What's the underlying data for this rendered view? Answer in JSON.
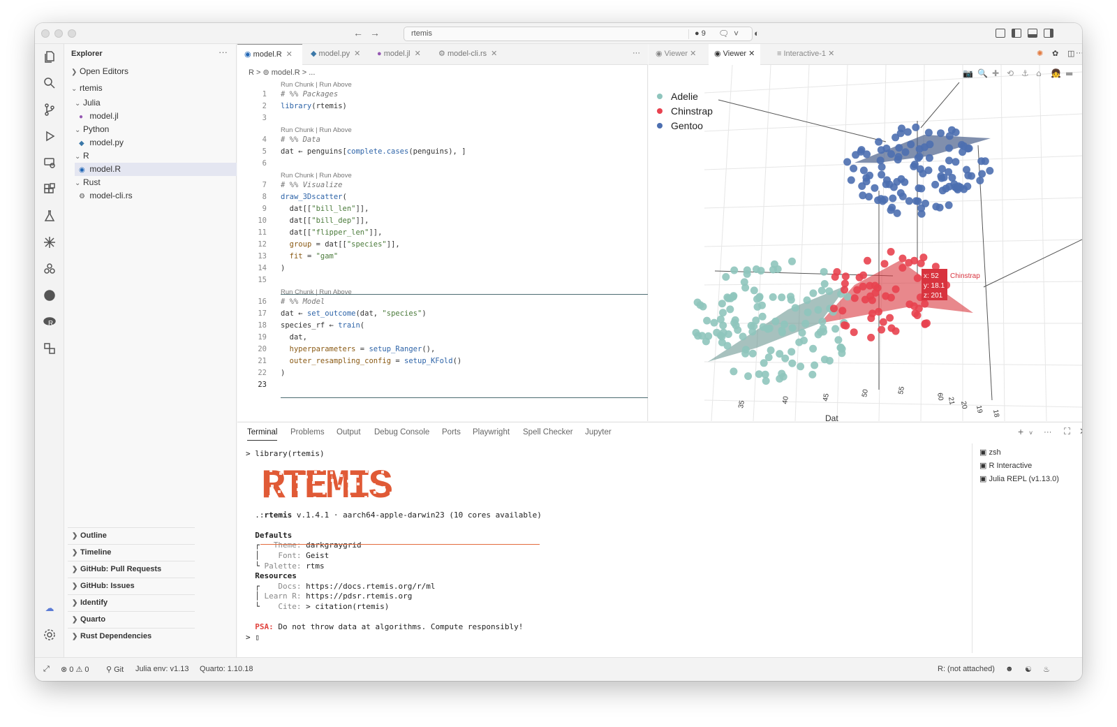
{
  "titlebar": {
    "search_text": "rtemis",
    "badge": "● 9"
  },
  "sidebar": {
    "title": "Explorer",
    "more": "···",
    "open_editors": "Open Editors",
    "folder": "rtemis",
    "tree": [
      {
        "label": "Julia",
        "type": "folder"
      },
      {
        "label": "model.jl",
        "type": "file"
      },
      {
        "label": "Python",
        "type": "folder"
      },
      {
        "label": "model.py",
        "type": "file"
      },
      {
        "label": "R",
        "type": "folder"
      },
      {
        "label": "model.R",
        "type": "file"
      },
      {
        "label": "Rust",
        "type": "folder"
      },
      {
        "label": "model-cli.rs",
        "type": "file"
      }
    ],
    "sections": [
      "Outline",
      "Timeline",
      "GitHub: Pull Requests",
      "GitHub: Issues",
      "Identify",
      "Quarto",
      "Rust Dependencies"
    ]
  },
  "editor": {
    "tabs": [
      "model.R",
      "model.py",
      "model.jl",
      "model-cli.rs"
    ],
    "more": "···",
    "breadcrumb": "R  >  ⊚ model.R  >  ...",
    "lens_label": "Run Chunk | Run Above",
    "lines": [
      {
        "n": "1",
        "text": "# %% Packages"
      },
      {
        "n": "2",
        "text": "library(rtemis)"
      },
      {
        "n": "3",
        "text": ""
      },
      {
        "n": "4",
        "text": "# %% Data"
      },
      {
        "n": "5",
        "text": "dat ← penguins[complete.cases(penguins), ]"
      },
      {
        "n": "6",
        "text": ""
      },
      {
        "n": "7",
        "text": "# %% Visualize"
      },
      {
        "n": "8",
        "text": "draw_3Dscatter("
      },
      {
        "n": "9",
        "text": "  dat[[\"bill_len\"]],"
      },
      {
        "n": "10",
        "text": "  dat[[\"bill_dep\"]],"
      },
      {
        "n": "11",
        "text": "  dat[[\"flipper_len\"]],"
      },
      {
        "n": "12",
        "text": "  group = dat[[\"species\"]],"
      },
      {
        "n": "13",
        "text": "  fit = \"gam\""
      },
      {
        "n": "14",
        "text": ")"
      },
      {
        "n": "15",
        "text": ""
      },
      {
        "n": "16",
        "text": "# %% Model"
      },
      {
        "n": "17",
        "text": "dat ← set_outcome(dat, \"species\")"
      },
      {
        "n": "18",
        "text": "species_rf ← train("
      },
      {
        "n": "19",
        "text": "  dat,"
      },
      {
        "n": "20",
        "text": "  hyperparameters = setup_Ranger(),"
      },
      {
        "n": "21",
        "text": "  outer_resampling_config = setup_KFold()"
      },
      {
        "n": "22",
        "text": ")"
      },
      {
        "n": "23",
        "text": ""
      }
    ]
  },
  "viewer": {
    "tabs": [
      "Viewer",
      "Viewer",
      "Interactive-1"
    ],
    "more": "···",
    "tooltip": {
      "x": "x: 52",
      "y": "y: 18.1",
      "z": "z: 201",
      "group": "Chinstrap"
    },
    "axis_ticks_x": [
      "35",
      "40",
      "45",
      "50",
      "55"
    ],
    "axis_ticks_y": [
      "60",
      "21",
      "20",
      "19",
      "18"
    ],
    "axis_partial": "Dat",
    "colors": {
      "Adelie": "#8fc5bd",
      "Chinstrap": "#e8424f",
      "Gentoo": "#4d6fb0"
    }
  },
  "chart_data": {
    "type": "scatter",
    "series": [
      {
        "name": "Adelie"
      },
      {
        "name": "Chinstrap"
      },
      {
        "name": "Gentoo"
      }
    ],
    "xticks": [
      "35",
      "40",
      "45",
      "50",
      "55"
    ],
    "yticks": [
      "60",
      "21",
      "20",
      "19",
      "18"
    ]
  },
  "panel": {
    "tabs": [
      "Terminal",
      "Problems",
      "Output",
      "Debug Console",
      "Ports",
      "Playwright",
      "Spell Checker",
      "Jupyter"
    ],
    "terminal_lines": [
      "> library(rtemis)",
      "",
      "",
      "",
      "",
      "",
      "  .:rtemis v.1.4.1 · aarch64-apple-darwin23 (10 cores available)",
      "",
      "  Defaults",
      "  ┌   Theme: darkgraygrid",
      "  │    Font: Geist",
      "  └ Palette: rtms",
      "  Resources",
      "  ┌    Docs: https://docs.rtemis.org/r/ml",
      "  │ Learn R: https://pdsr.rtemis.org",
      "  └    Cite: > citation(rtemis)",
      "",
      "  PSA: Do not throw data at algorithms. Compute responsibly!",
      "> ▯"
    ],
    "logo_text": "RTEMIS",
    "terminals": [
      "zsh",
      "R Interactive",
      "Julia REPL (v1.13.0)"
    ]
  },
  "status": {
    "errors": "⊗ 0 ⚠ 0",
    "git": "Git",
    "julia_env": "Julia env: v1.13",
    "quarto": "Quarto: 1.10.18",
    "r_status": "R: (not attached)"
  }
}
